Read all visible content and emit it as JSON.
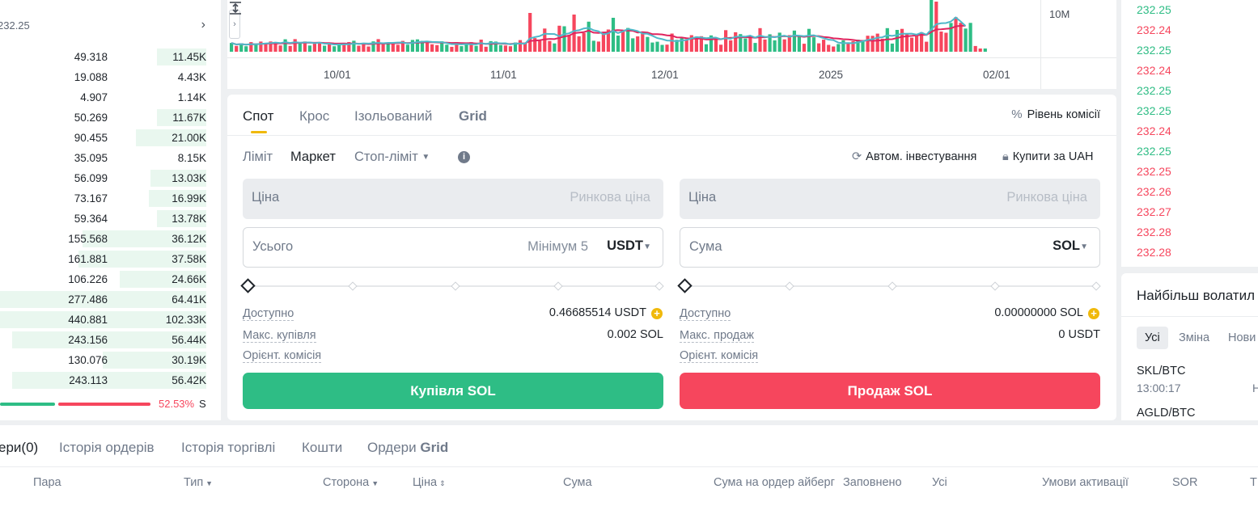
{
  "orderbook": {
    "price_label": "232.25",
    "rows": [
      {
        "amount": "49.318",
        "total": "11.45K",
        "depth": 0.24
      },
      {
        "amount": "19.088",
        "total": "4.43K",
        "depth": 0.0
      },
      {
        "amount": "4.907",
        "total": "1.14K",
        "depth": 0.0
      },
      {
        "amount": "50.269",
        "total": "11.67K",
        "depth": 0.24
      },
      {
        "amount": "90.455",
        "total": "21.00K",
        "depth": 0.34
      },
      {
        "amount": "35.095",
        "total": "8.15K",
        "depth": 0.0
      },
      {
        "amount": "56.099",
        "total": "13.03K",
        "depth": 0.27
      },
      {
        "amount": "73.167",
        "total": "16.99K",
        "depth": 0.28
      },
      {
        "amount": "59.364",
        "total": "13.78K",
        "depth": 0.24
      },
      {
        "amount": "155.568",
        "total": "36.12K",
        "depth": 0.6
      },
      {
        "amount": "161.881",
        "total": "37.58K",
        "depth": 0.62
      },
      {
        "amount": "106.226",
        "total": "24.66K",
        "depth": 0.42
      },
      {
        "amount": "277.486",
        "total": "64.41K",
        "depth": 1.0
      },
      {
        "amount": "440.881",
        "total": "102.33K",
        "depth": 1.0
      },
      {
        "amount": "243.156",
        "total": "56.44K",
        "depth": 0.94
      },
      {
        "amount": "130.076",
        "total": "30.19K",
        "depth": 0.5
      },
      {
        "amount": "243.113",
        "total": "56.42K",
        "depth": 0.94
      }
    ],
    "sell_ratio": "52.53%",
    "ratio_suffix": "S"
  },
  "chart": {
    "volume_axis_label": "10M",
    "x_labels": [
      "10/01",
      "11/01",
      "12/01",
      "2025",
      "02/01"
    ],
    "up_color": "#2ebd85",
    "down_color": "#f6465d",
    "ma1_color": "#e0245e",
    "ma2_color": "#4fb8c9"
  },
  "trade": {
    "tabs": [
      "Спот",
      "Крос",
      "Ізольований",
      "Grid"
    ],
    "fee_level": "Рівень комісії",
    "order_types": [
      "Ліміт",
      "Маркет",
      "Стоп-ліміт"
    ],
    "auto_invest": "Автом. інвестування",
    "buy_uah": "Купити за UAH",
    "buy": {
      "price_label": "Ціна",
      "price_hint": "Ринкова ціна",
      "total_label": "Усього",
      "min_hint": "Мінімум 5",
      "unit": "USDT",
      "available_label": "Доступно",
      "available_value": "0.46685514 USDT",
      "max_label": "Макс. купівля",
      "max_value": "0.002 SOL",
      "fee_label": "Орієнт. комісія",
      "button": "Купівля SOL"
    },
    "sell": {
      "price_label": "Ціна",
      "price_hint": "Ринкова ціна",
      "amount_label": "Сума",
      "unit": "SOL",
      "available_label": "Доступно",
      "available_value": "0.00000000 SOL",
      "max_label": "Макс. продаж",
      "max_value": "0 USDT",
      "fee_label": "Орієнт. комісія",
      "button": "Продаж SOL"
    }
  },
  "trades": [
    {
      "price": "232.25",
      "dir": "up"
    },
    {
      "price": "232.24",
      "dir": "dn"
    },
    {
      "price": "232.25",
      "dir": "up"
    },
    {
      "price": "232.24",
      "dir": "dn"
    },
    {
      "price": "232.25",
      "dir": "up"
    },
    {
      "price": "232.25",
      "dir": "up"
    },
    {
      "price": "232.24",
      "dir": "dn"
    },
    {
      "price": "232.25",
      "dir": "up"
    },
    {
      "price": "232.25",
      "dir": "dn"
    },
    {
      "price": "232.26",
      "dir": "dn"
    },
    {
      "price": "232.27",
      "dir": "dn"
    },
    {
      "price": "232.28",
      "dir": "dn"
    },
    {
      "price": "232.28",
      "dir": "dn"
    }
  ],
  "volatile": {
    "title": "Найбільш волатил",
    "tabs": [
      "Усі",
      "Зміна",
      "Нови"
    ],
    "items": [
      {
        "pair": "SKL/BTC",
        "time": "13:00:17",
        "tail": "Н"
      },
      {
        "pair": "AGLD/BTC",
        "time": "",
        "tail": ""
      }
    ]
  },
  "orders": {
    "tabs": [
      "ери(0)",
      "Історія ордерів",
      "Історія торгівлі",
      "Кошти",
      "Ордери Grid"
    ],
    "columns": [
      "Пара",
      "Тип",
      "Сторона",
      "Ціна",
      "Сума",
      "Сума на ордер айберг",
      "Заповнено",
      "Усі",
      "Умови активації",
      "SOR",
      "Т"
    ]
  }
}
